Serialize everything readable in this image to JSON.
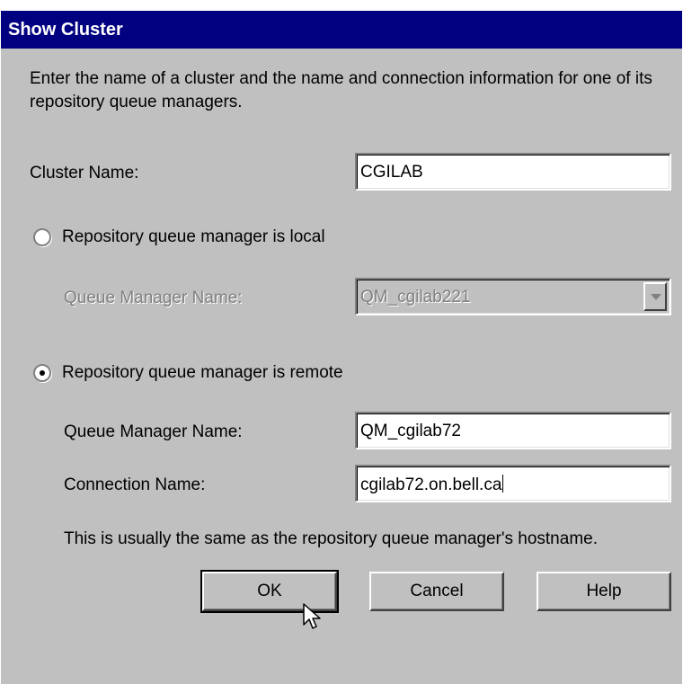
{
  "dialog": {
    "title": "Show Cluster",
    "description": "Enter the name of a cluster and the name and connection information for one of its repository queue managers."
  },
  "cluster_name": {
    "label": "Cluster Name:",
    "value": "CGILAB"
  },
  "local_option": {
    "label": "Repository queue manager is local",
    "selected": false,
    "qm_label": "Queue Manager Name:",
    "qm_value": "QM_cgilab221"
  },
  "remote_option": {
    "label": "Repository queue manager is remote",
    "selected": true,
    "qm_label": "Queue Manager Name:",
    "qm_value": "QM_cgilab72",
    "conn_label": "Connection Name:",
    "conn_value": "cgilab72.on.bell.ca",
    "hint": "This is usually the same as the repository queue manager's hostname."
  },
  "buttons": {
    "ok": "OK",
    "cancel": "Cancel",
    "help": "Help"
  },
  "colors": {
    "titlebar": "#000080",
    "dialog_bg": "#c0c0c0"
  }
}
